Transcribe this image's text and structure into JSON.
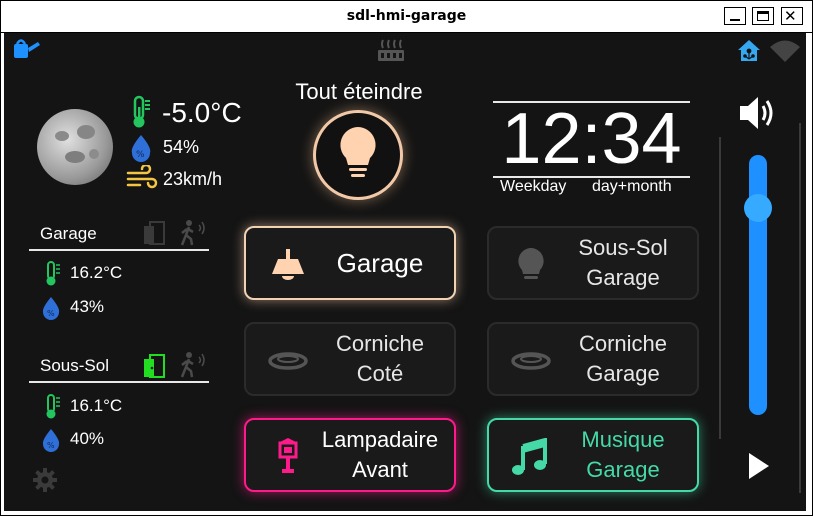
{
  "window": {
    "title": "sdl-hmi-garage"
  },
  "weather": {
    "temp": "-5.0°C",
    "humidity": "54%",
    "wind": "23km/h"
  },
  "zones": [
    {
      "name": "Garage",
      "temp": "16.2°C",
      "humidity": "43%"
    },
    {
      "name": "Sous-Sol",
      "temp": "16.1°C",
      "humidity": "40%"
    }
  ],
  "all_off": {
    "label": "Tout éteindre"
  },
  "clock": {
    "time": "12:34",
    "weekday": "Weekday",
    "daymonth": "day+month"
  },
  "buttons": [
    {
      "label": "Garage",
      "state": "on",
      "icon": "ceiling-lamp-icon",
      "color": "#ffd2b0"
    },
    {
      "label": "Sous-Sol\nGarage",
      "state": "off",
      "icon": "bulb-icon"
    },
    {
      "label": "Corniche\nCoté",
      "state": "off",
      "icon": "ring-light-icon"
    },
    {
      "label": "Corniche\nGarage",
      "state": "off",
      "icon": "ring-light-icon"
    },
    {
      "label": "Lampadaire\nAvant",
      "state": "on",
      "icon": "street-lamp-icon",
      "color": "#ff1a8c"
    },
    {
      "label": "Musique\nGarage",
      "state": "on",
      "icon": "music-note-icon",
      "color": "#44d9a6"
    }
  ],
  "volume": {
    "level": 0.83
  },
  "colors": {
    "accent_blue": "#1e90ff",
    "thermo_green": "#22c55e",
    "wind_yellow": "#f4c542",
    "door_green": "#22dd22"
  }
}
